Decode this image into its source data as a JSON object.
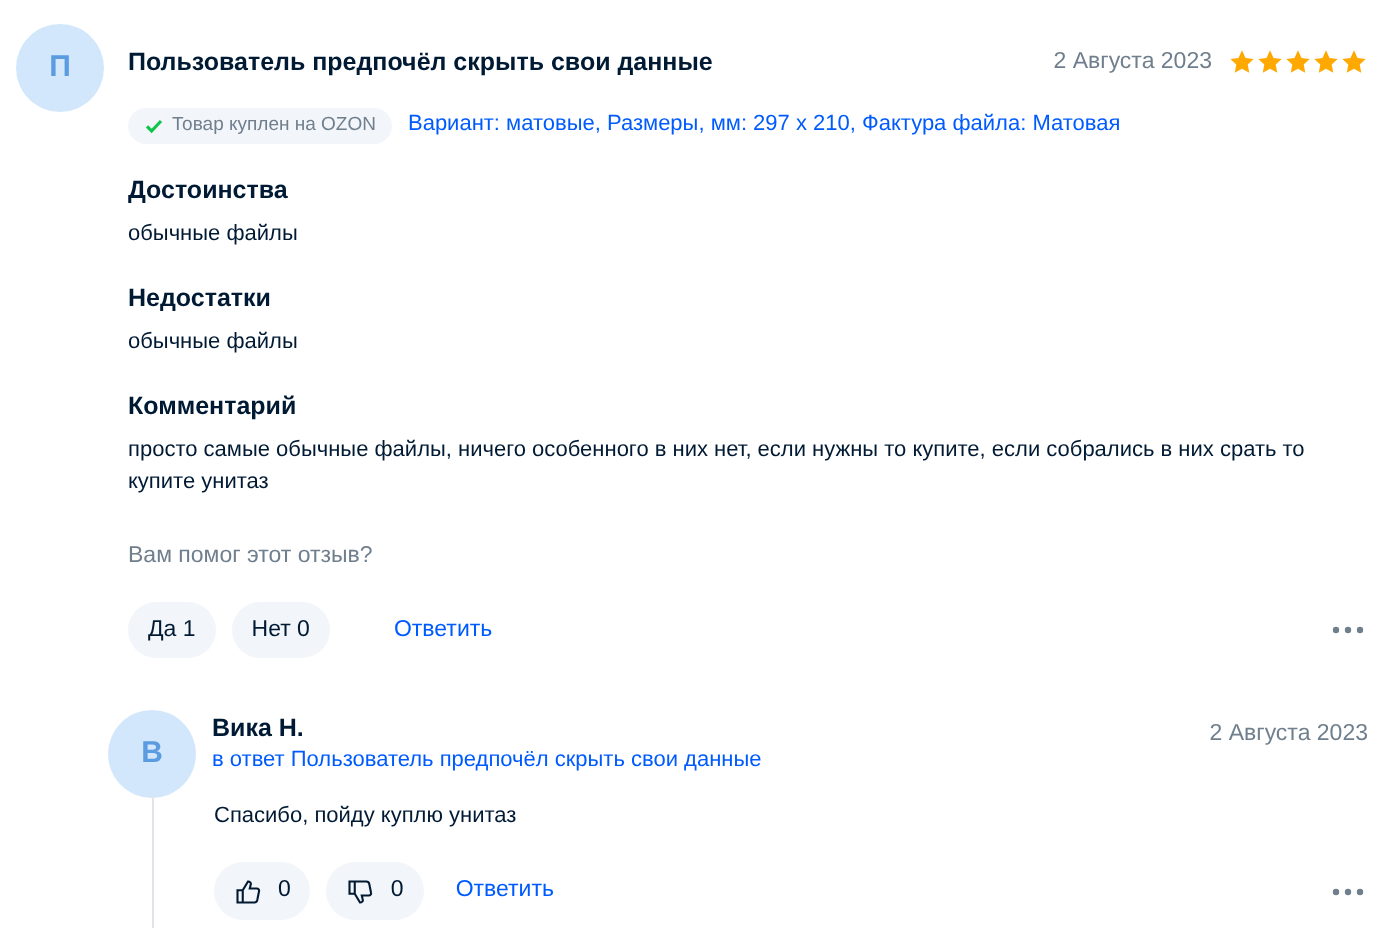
{
  "review": {
    "avatar_letter": "П",
    "author": "Пользователь предпочёл скрыть свои данные",
    "date": "2 Августа 2023",
    "stars": 5,
    "purchase_badge": "Товар куплен на OZON",
    "variant": "Вариант: матовые, Размеры, мм: 297 x 210, Фактура файла: Матовая",
    "sections": [
      {
        "title": "Достоинства",
        "text": "обычные файлы"
      },
      {
        "title": "Недостатки",
        "text": "обычные файлы"
      },
      {
        "title": "Комментарий",
        "text": "просто самые обычные файлы, ничего особенного в них нет, если нужны то купите, если собрались в них срать то купите унитаз"
      }
    ],
    "helpful_question": "Вам помог этот отзыв?",
    "votes": [
      {
        "label": "Да 1"
      },
      {
        "label": "Нет 0"
      }
    ],
    "reply_link": "Ответить"
  },
  "reply": {
    "avatar_letter": "В",
    "author": "Вика Н.",
    "in_reply_to": "в ответ Пользователь предпочёл скрыть свои данные",
    "date": "2 Августа 2023",
    "text": "Спасибо, пойду куплю унитаз",
    "votes": [
      {
        "kind": "like",
        "count": "0"
      },
      {
        "kind": "dislike",
        "count": "0"
      }
    ],
    "reply_link": "Ответить"
  }
}
